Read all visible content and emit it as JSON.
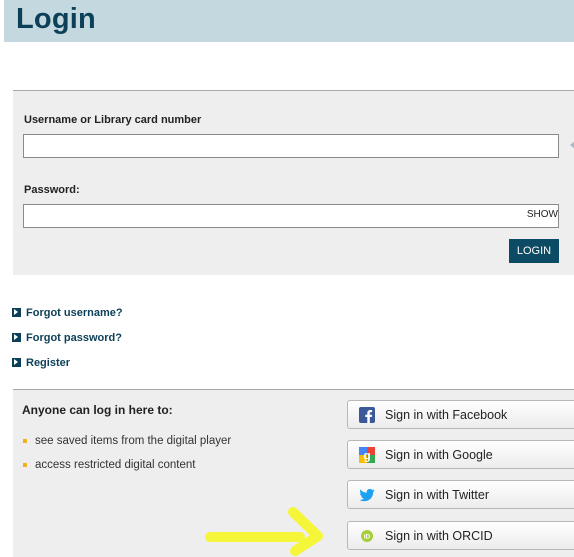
{
  "page": {
    "title": "Login"
  },
  "form": {
    "username_label": "Username or Library card number",
    "username_value": "",
    "password_label": "Password:",
    "password_value": "",
    "show_label": "SHOW",
    "login_label": "LOGIN"
  },
  "links": [
    {
      "label": "Forgot username?"
    },
    {
      "label": "Forgot password?"
    },
    {
      "label": "Register"
    }
  ],
  "social": {
    "heading": "Anyone can log in here to:",
    "benefits": [
      "see saved items from the digital player",
      "access restricted digital content"
    ],
    "buttons": {
      "facebook": "Sign in with Facebook",
      "google": "Sign in with Google",
      "twitter": "Sign in with Twitter",
      "orcid": "Sign in with ORCID"
    }
  },
  "colors": {
    "brand": "#0c3f58",
    "header_bg": "#c4d8df",
    "panel_bg": "#eeeeee",
    "bullet": "#f2b317",
    "facebook": "#3b5998",
    "twitter": "#1da1f2",
    "orcid": "#a6ce39",
    "annotation_arrow": "#f5f53a"
  }
}
